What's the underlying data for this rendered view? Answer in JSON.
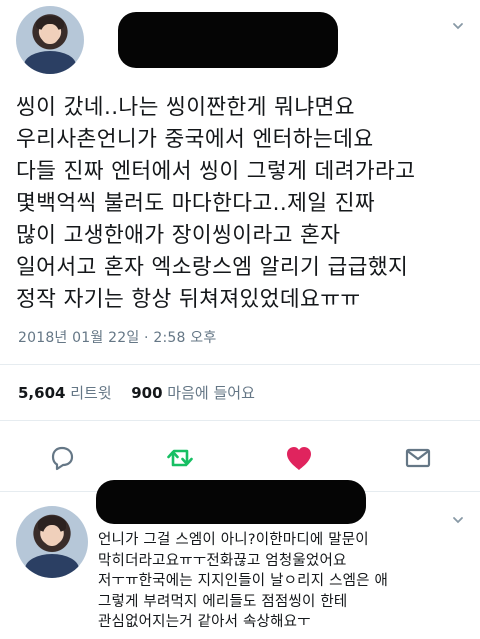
{
  "tweet": {
    "text_lines": [
      "씽이 갔네..나는 씽이짠한게 뭐냐면요",
      "우리사촌언니가 중국에서 엔터하는데요",
      "다들 진짜 엔터에서 씽이 그렇게 데려가라고",
      "몇백억씩 불러도 마다한다고..제일 진짜",
      "많이 고생한애가 장이씽이라고 혼자",
      "일어서고 혼자 엑소랑스엠 알리기 급급했지",
      "정작 자기는 항상 뒤쳐져있었데요ㅠㅠ"
    ],
    "timestamp": "2018년 01월 22일 · 2:58 오후",
    "retweet_count": "5,604",
    "retweet_label": "리트윗",
    "like_count": "900",
    "like_label": "마음에 들어요"
  },
  "actions": {
    "reply_icon": "reply-icon",
    "retweet_icon": "retweet-icon",
    "like_icon": "heart-icon",
    "dm_icon": "envelope-icon",
    "retweet_color": "#17bf63",
    "like_color": "#e0245e",
    "icon_color": "#657786"
  },
  "reply": {
    "text_lines": [
      "언니가 그걸 스엠이 아니?이한마디에 말문이",
      "막히더라고요ㅠㅜ전화끊고 엄청울었어요",
      "저ㅜㅠ한국에는 지지인들이 날ㅇ리지 스엠은 애",
      "그렇게 부려먹지 에리들도 점점씽이 한테",
      "관심없어지는거 같아서 속상해요ㅜ"
    ]
  }
}
